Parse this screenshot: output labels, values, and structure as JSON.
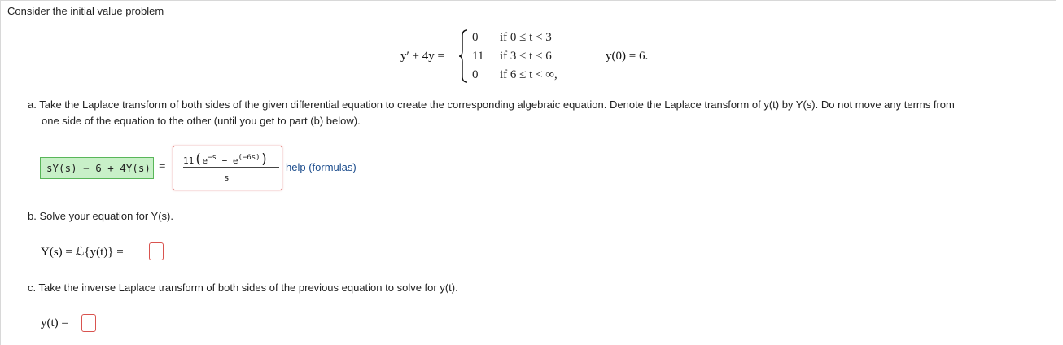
{
  "intro": "Consider the initial value problem",
  "ode": {
    "lhs": "y′ + 4y =",
    "cases": [
      {
        "value": "0",
        "condition": "if 0 ≤ t < 3"
      },
      {
        "value": "11",
        "condition": "if 3 ≤ t < 6"
      },
      {
        "value": "0",
        "condition": "if 6 ≤ t < ∞,"
      }
    ],
    "initial_condition": "y(0) = 6."
  },
  "part_a": {
    "text_line1": "a. Take the Laplace transform of both sides of the given differential equation to create the corresponding algebraic equation. Denote the Laplace transform of y(t) by Y(s). Do not move any terms from",
    "text_line2": "one side of the equation to the other (until you get to part (b) below).",
    "answer_left": "sY(s) − 6 + 4Y(s)",
    "equals": "=",
    "answer_right_numerator_coef": "11",
    "answer_right_exp1": "−s",
    "answer_right_exp2": "(−6s)",
    "answer_right_denominator": "s",
    "help_link": "help (formulas)"
  },
  "part_b": {
    "text": "b. Solve your equation for Y(s).",
    "expr": "Y(s) = ℒ{y(t)} ="
  },
  "part_c": {
    "text": "c. Take the inverse Laplace transform of both sides of the previous equation to solve for y(t).",
    "expr": "y(t) ="
  }
}
